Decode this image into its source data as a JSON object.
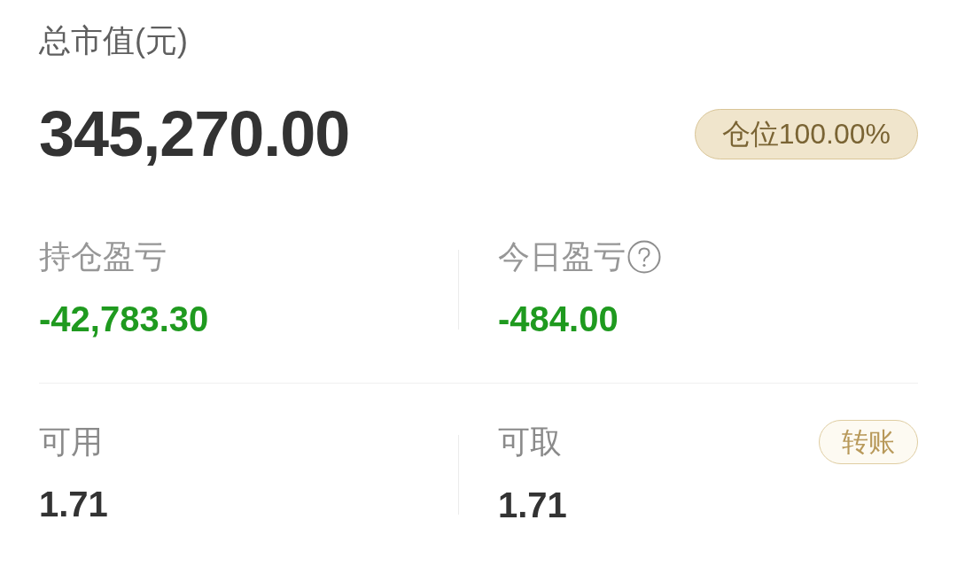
{
  "total": {
    "label": "总市值(元)",
    "value": "345,270.00",
    "position_badge": "仓位100.00%"
  },
  "pnl": [
    {
      "label": "持仓盈亏",
      "value": "-42,783.30",
      "help": false,
      "kind": "loss"
    },
    {
      "label": "今日盈亏",
      "value": "-484.00",
      "help": true,
      "kind": "loss"
    }
  ],
  "funds": [
    {
      "label": "可用",
      "value": "1.71"
    },
    {
      "label": "可取",
      "value": "1.71",
      "action": "转账"
    }
  ]
}
